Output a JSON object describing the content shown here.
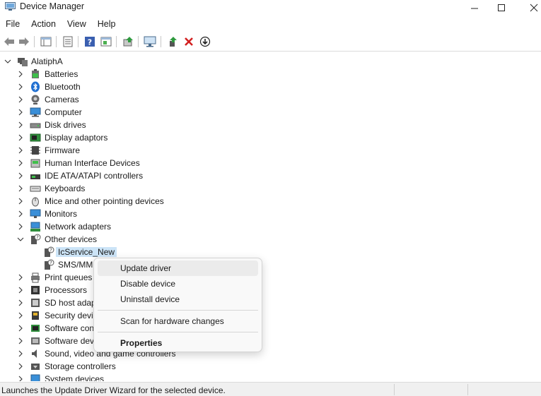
{
  "window": {
    "title": "Device Manager"
  },
  "menu": [
    "File",
    "Action",
    "View",
    "Help"
  ],
  "toolbar": {
    "icons": [
      "back-arrow-icon",
      "forward-arrow-icon",
      "show-hide-tree-icon",
      "properties-icon",
      "help-icon",
      "action-pane-icon",
      "update-driver-icon",
      "scan-hardware-icon",
      "add-legacy-icon",
      "uninstall-icon",
      "disable-device-icon"
    ]
  },
  "tree": {
    "root": "AlatiphA",
    "categories": [
      {
        "label": "Batteries",
        "icon": "battery-icon",
        "expanded": false
      },
      {
        "label": "Bluetooth",
        "icon": "bluetooth-icon",
        "expanded": false
      },
      {
        "label": "Cameras",
        "icon": "camera-icon",
        "expanded": false
      },
      {
        "label": "Computer",
        "icon": "computer-icon",
        "expanded": false
      },
      {
        "label": "Disk drives",
        "icon": "disk-drive-icon",
        "expanded": false
      },
      {
        "label": "Display adaptors",
        "icon": "display-adapter-icon",
        "expanded": false
      },
      {
        "label": "Firmware",
        "icon": "firmware-icon",
        "expanded": false
      },
      {
        "label": "Human Interface Devices",
        "icon": "hid-icon",
        "expanded": false
      },
      {
        "label": "IDE ATA/ATAPI controllers",
        "icon": "ide-controller-icon",
        "expanded": false
      },
      {
        "label": "Keyboards",
        "icon": "keyboard-icon",
        "expanded": false
      },
      {
        "label": "Mice and other pointing devices",
        "icon": "mouse-icon",
        "expanded": false
      },
      {
        "label": "Monitors",
        "icon": "monitor-icon",
        "expanded": false
      },
      {
        "label": "Network adapters",
        "icon": "network-adapter-icon",
        "expanded": false
      },
      {
        "label": "Other devices",
        "icon": "unknown-device-icon",
        "expanded": true
      },
      {
        "label": "Print queues",
        "icon": "printer-icon",
        "expanded": false
      },
      {
        "label": "Processors",
        "icon": "processor-icon",
        "expanded": false
      },
      {
        "label": "SD host adap",
        "icon": "sd-host-icon",
        "expanded": false
      },
      {
        "label": "Security devi",
        "icon": "security-device-icon",
        "expanded": false
      },
      {
        "label": "Software con",
        "icon": "software-component-icon",
        "expanded": false
      },
      {
        "label": "Software dev",
        "icon": "software-device-icon",
        "expanded": false
      },
      {
        "label": "Sound, video and game controllers",
        "icon": "sound-icon",
        "expanded": false
      },
      {
        "label": "Storage controllers",
        "icon": "storage-controller-icon",
        "expanded": false
      },
      {
        "label": "System devices",
        "icon": "system-device-icon",
        "expanded": false
      }
    ],
    "other_devices_children": [
      {
        "label": "IcService_New",
        "selected": true
      },
      {
        "label": "SMS/MM",
        "selected": false
      }
    ]
  },
  "context_menu": {
    "items": [
      {
        "label": "Update driver",
        "bold": false,
        "hover": true
      },
      {
        "label": "Disable device",
        "bold": false
      },
      {
        "label": "Uninstall device",
        "bold": false
      },
      {
        "label": "Scan for hardware changes",
        "bold": false
      },
      {
        "label": "Properties",
        "bold": true
      }
    ]
  },
  "status": {
    "text": "Launches the Update Driver Wizard for the selected device."
  }
}
